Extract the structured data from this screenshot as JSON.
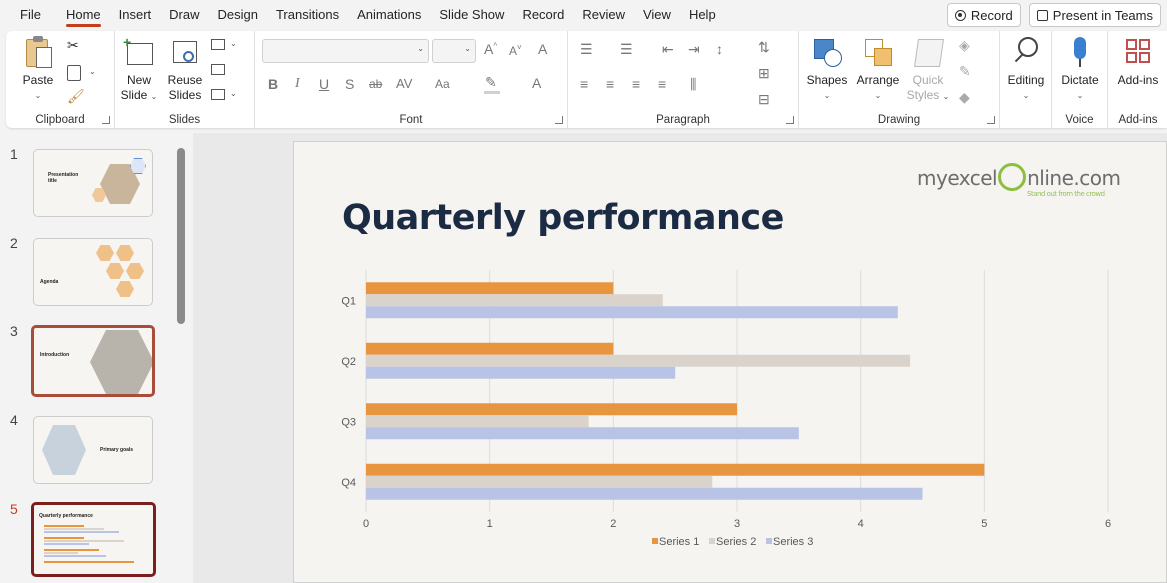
{
  "menu": {
    "items": [
      "File",
      "Home",
      "Insert",
      "Draw",
      "Design",
      "Transitions",
      "Animations",
      "Slide Show",
      "Record",
      "Review",
      "View",
      "Help"
    ],
    "active": "Home",
    "record_button": "Record",
    "present_button": "Present in Teams"
  },
  "ribbon": {
    "clipboard": {
      "label": "Clipboard",
      "paste": "Paste"
    },
    "slides": {
      "label": "Slides",
      "new_slide_1": "New",
      "new_slide_2": "Slide",
      "reuse_1": "Reuse",
      "reuse_2": "Slides"
    },
    "font": {
      "label": "Font"
    },
    "paragraph": {
      "label": "Paragraph"
    },
    "drawing": {
      "label": "Drawing",
      "shapes": "Shapes",
      "arrange": "Arrange",
      "quick_1": "Quick",
      "quick_2": "Styles"
    },
    "editing": {
      "label": "Editing"
    },
    "voice": {
      "label": "Voice",
      "dictate": "Dictate"
    },
    "addins": {
      "label": "Add-ins",
      "addins": "Add-ins"
    }
  },
  "thumbnails": [
    {
      "num": "1",
      "title": "Presentation title"
    },
    {
      "num": "2",
      "title": "Agenda"
    },
    {
      "num": "3",
      "title": "Introduction"
    },
    {
      "num": "4",
      "title": "Primary goals"
    },
    {
      "num": "5",
      "title": "Quarterly performance"
    }
  ],
  "slide": {
    "title": "Quarterly performance",
    "logo_text_1": "myexcel",
    "logo_text_2": "nline.com",
    "logo_tagline": "Stand out from the crowd"
  },
  "colors": {
    "series1": "#e8953f",
    "series2": "#d9d3cc",
    "series3": "#b8c3e6",
    "accent": "#c43e1c"
  },
  "chart_data": {
    "type": "bar",
    "orientation": "horizontal",
    "categories": [
      "Q1",
      "Q2",
      "Q3",
      "Q4"
    ],
    "series": [
      {
        "name": "Series 1",
        "values": [
          2,
          2,
          3,
          5
        ]
      },
      {
        "name": "Series 2",
        "values": [
          2.4,
          4.4,
          1.8,
          2.8
        ]
      },
      {
        "name": "Series 3",
        "values": [
          4.3,
          2.5,
          3.5,
          4.5
        ]
      }
    ],
    "xlim": [
      0,
      6
    ],
    "xticks": [
      "0",
      "1",
      "2",
      "3",
      "4",
      "5",
      "6"
    ],
    "grid": true,
    "legend": "bottom"
  }
}
